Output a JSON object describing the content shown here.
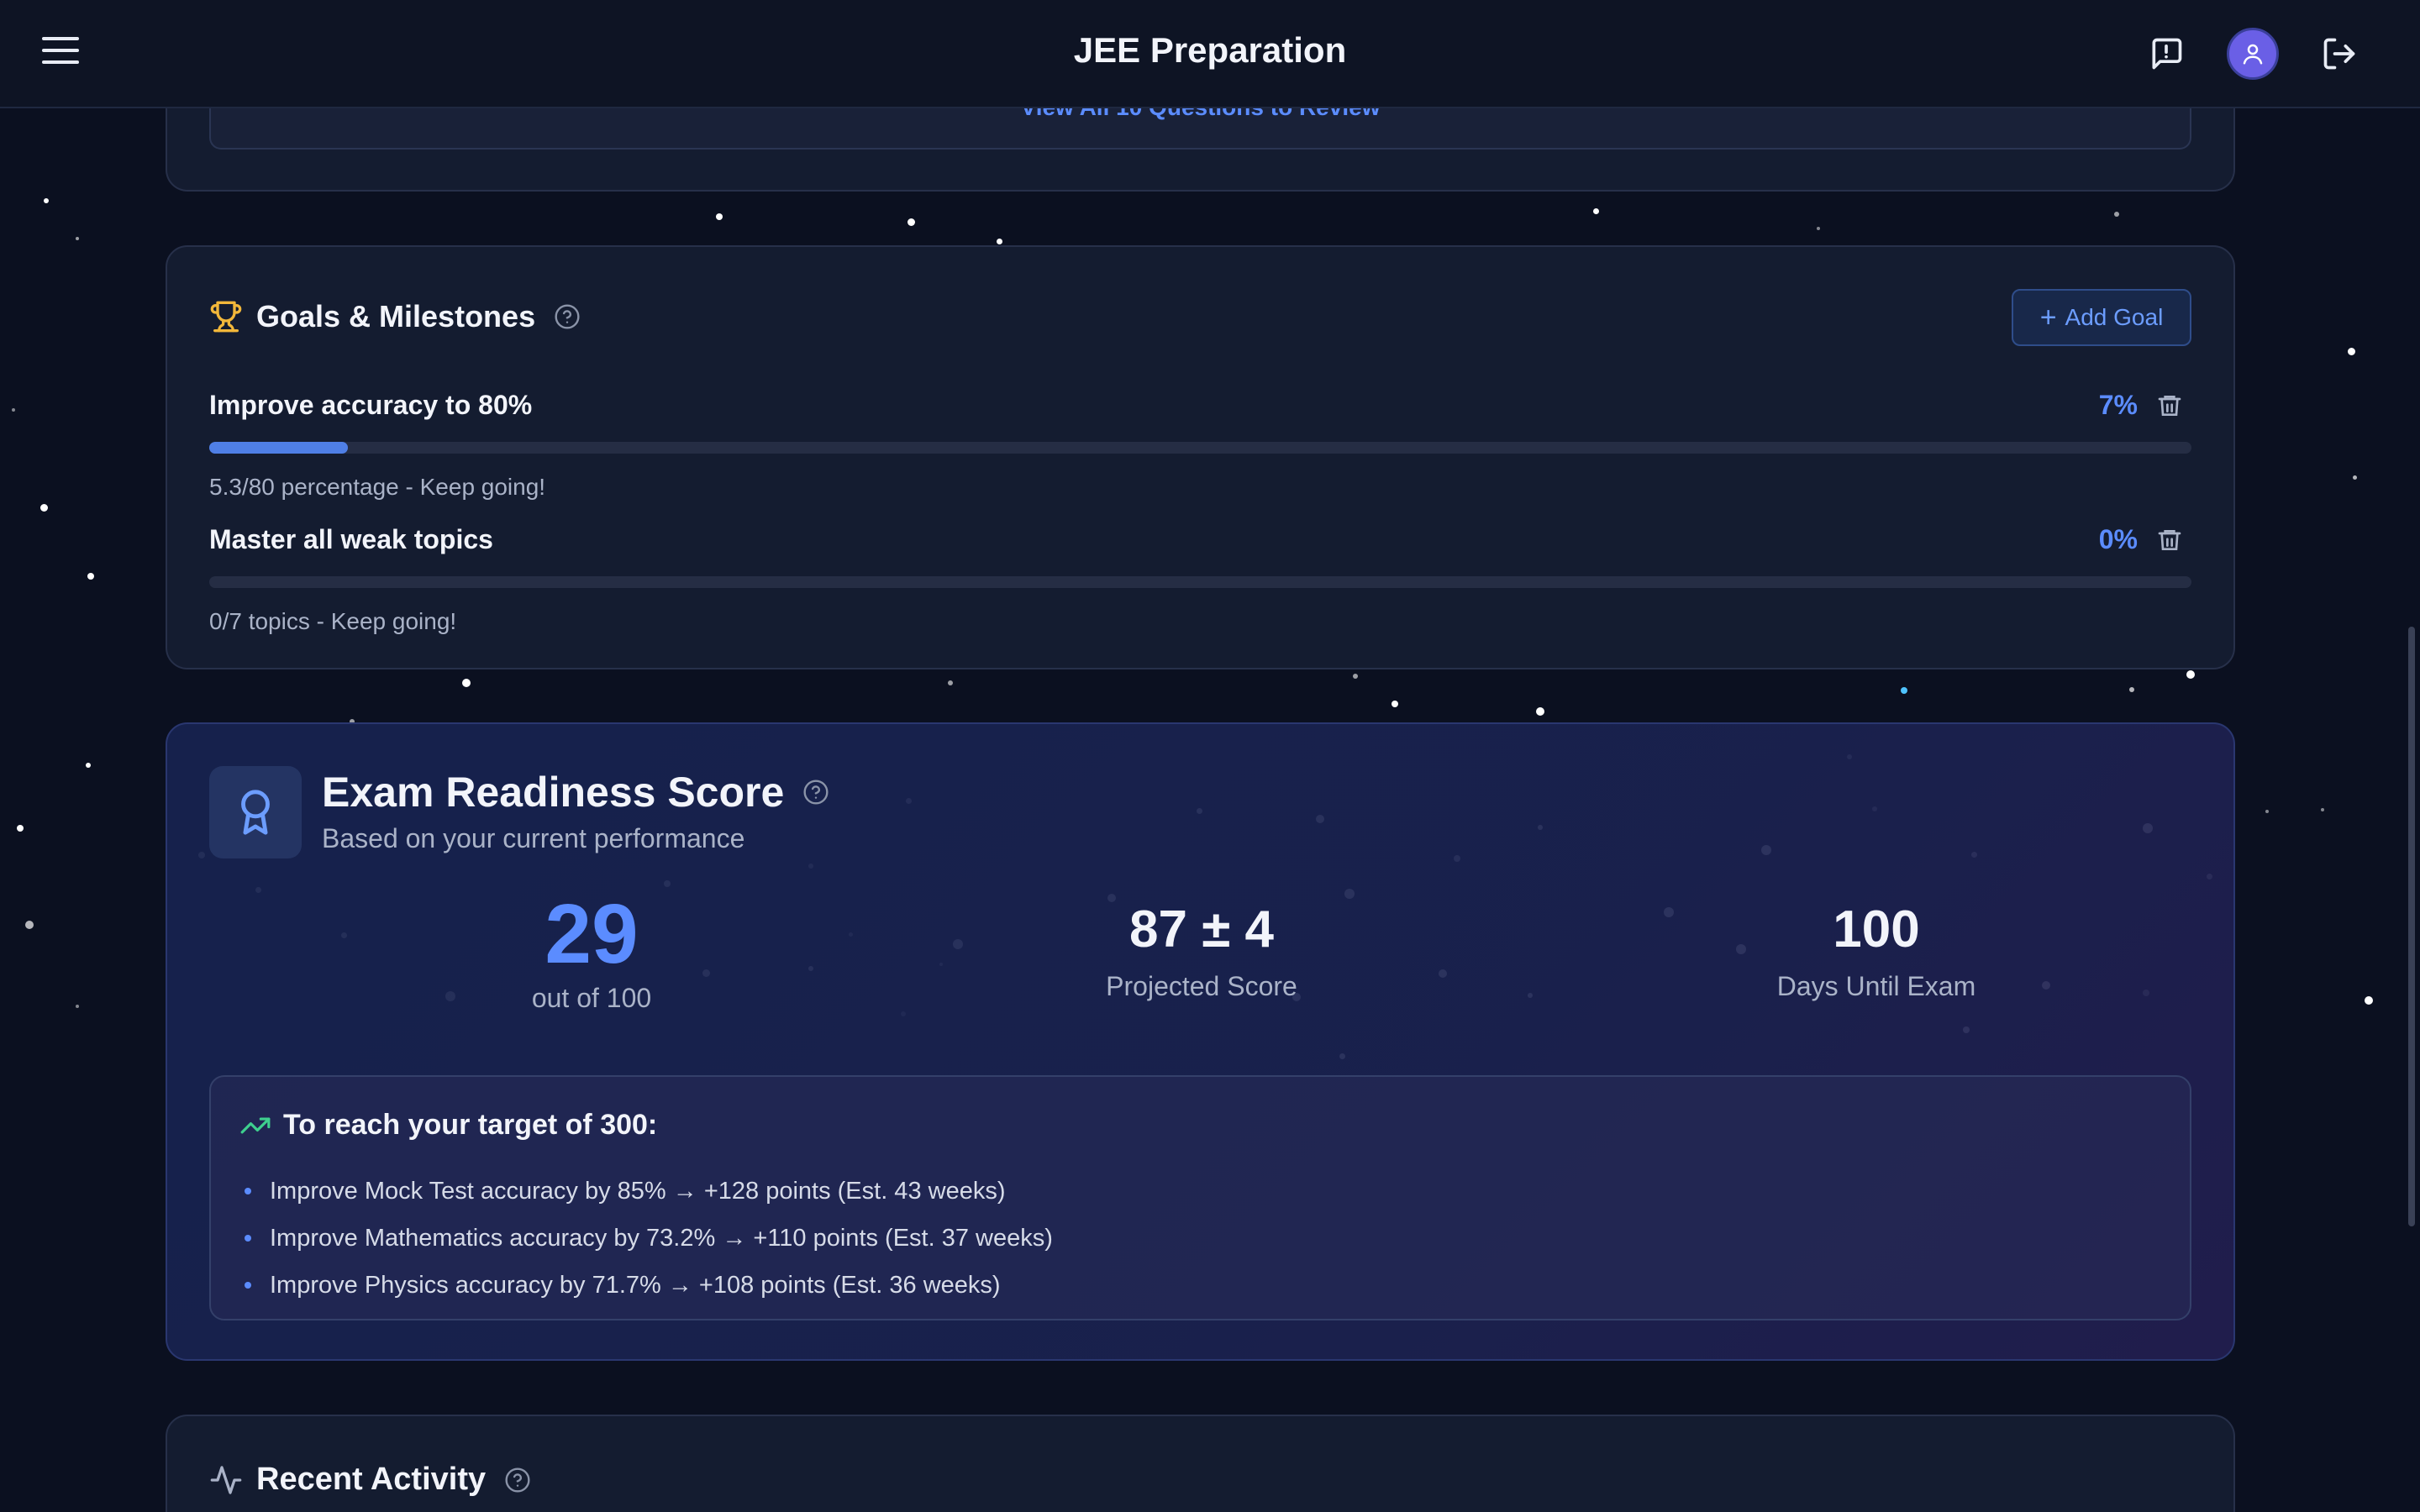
{
  "header": {
    "title": "JEE Preparation"
  },
  "previous_card": {
    "review_link": "View All 10 Questions to Review"
  },
  "goals": {
    "heading": "Goals & Milestones",
    "add_button": "Add Goal",
    "items": [
      {
        "title": "Improve accuracy to 80%",
        "percent_label": "7%",
        "progress": 0.07,
        "note": "5.3/80 percentage - Keep going!"
      },
      {
        "title": "Master all weak topics",
        "percent_label": "0%",
        "progress": 0.0,
        "note": "0/7 topics - Keep going!"
      }
    ]
  },
  "readiness": {
    "heading": "Exam Readiness Score",
    "subtitle": "Based on your current performance",
    "score": "29",
    "score_label": "out of 100",
    "projected": "87 ± 4",
    "projected_label": "Projected Score",
    "days": "100",
    "days_label": "Days Until Exam",
    "target_heading": "To reach your target of 300:",
    "tips": [
      "Improve Mock Test accuracy by 85% → +128 points (Est. 43 weeks)",
      "Improve Mathematics accuracy by 73.2% → +110 points (Est. 37 weeks)",
      "Improve Physics accuracy by 71.7% → +108 points (Est. 36 weeks)"
    ]
  },
  "activity": {
    "heading": "Recent Activity"
  },
  "colors": {
    "accent": "#5b8cff",
    "background": "#0b1020",
    "card": "#161d32",
    "trophy": "#f2b73a",
    "trend": "#3ecf8e"
  }
}
